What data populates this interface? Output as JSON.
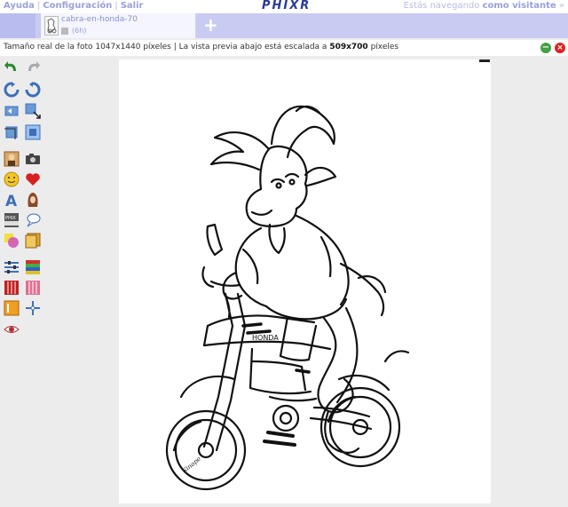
{
  "header": {
    "links": [
      "Ayuda",
      "Configuración",
      "Salir"
    ],
    "logo": "PHIXR",
    "visitor_prefix": "Estás navegando",
    "visitor_bold": "como visitante",
    "visitor_suffix": "»"
  },
  "tab": {
    "title": "cabra-en-honda-70",
    "sub": "(6h)",
    "add_label": "+"
  },
  "info": {
    "prefix": "Tamaño real de la foto 1047x1440 píxeles | La vista previa abajo está escalada a ",
    "scaled": "509x700",
    "suffix": " píxeles"
  },
  "actions": {
    "ok": "−",
    "close": "×"
  },
  "tools": [
    {
      "name": "undo-icon",
      "color": "#2a8a2a"
    },
    {
      "name": "redo-icon",
      "color": "#aaaaaa"
    },
    {
      "name": "rotate-left-icon",
      "color": "#3d6fb8"
    },
    {
      "name": "rotate-right-icon",
      "color": "#3d6fb8"
    },
    {
      "name": "flip-horizontal-icon",
      "color": "#3d6fb8"
    },
    {
      "name": "resize-icon",
      "color": "#3d6fb8"
    },
    {
      "name": "crop-icon",
      "color": "#3d6fb8"
    },
    {
      "name": "crop-frame-icon",
      "color": "#3d6fb8"
    },
    {
      "name": "portrait-icon",
      "color": "#c88a3a"
    },
    {
      "name": "camera-icon",
      "color": "#333333"
    },
    {
      "name": "smiley-icon",
      "color": "#f0c020"
    },
    {
      "name": "heart-icon",
      "color": "#d02020"
    },
    {
      "name": "text-icon",
      "color": "#3d6fb8"
    },
    {
      "name": "hair-icon",
      "color": "#8a4a2a"
    },
    {
      "name": "phixr-badge-icon",
      "color": "#555555"
    },
    {
      "name": "speech-bubble-icon",
      "color": "#3d6fb8"
    },
    {
      "name": "shapes-icon",
      "color": "#d04fa0"
    },
    {
      "name": "frame-icon",
      "color": "#c89020"
    },
    {
      "name": "adjust-sliders-icon",
      "color": "#3d6fb8"
    },
    {
      "name": "color-palette-icon",
      "color": "#3da040"
    },
    {
      "name": "border-red-icon",
      "color": "#c02020"
    },
    {
      "name": "border-pink-icon",
      "color": "#d06080"
    },
    {
      "name": "filter-orange-icon",
      "color": "#f0a020"
    },
    {
      "name": "sharpen-cross-icon",
      "color": "#3d6fb8"
    },
    {
      "name": "eye-icon",
      "color": "#b03030"
    }
  ]
}
